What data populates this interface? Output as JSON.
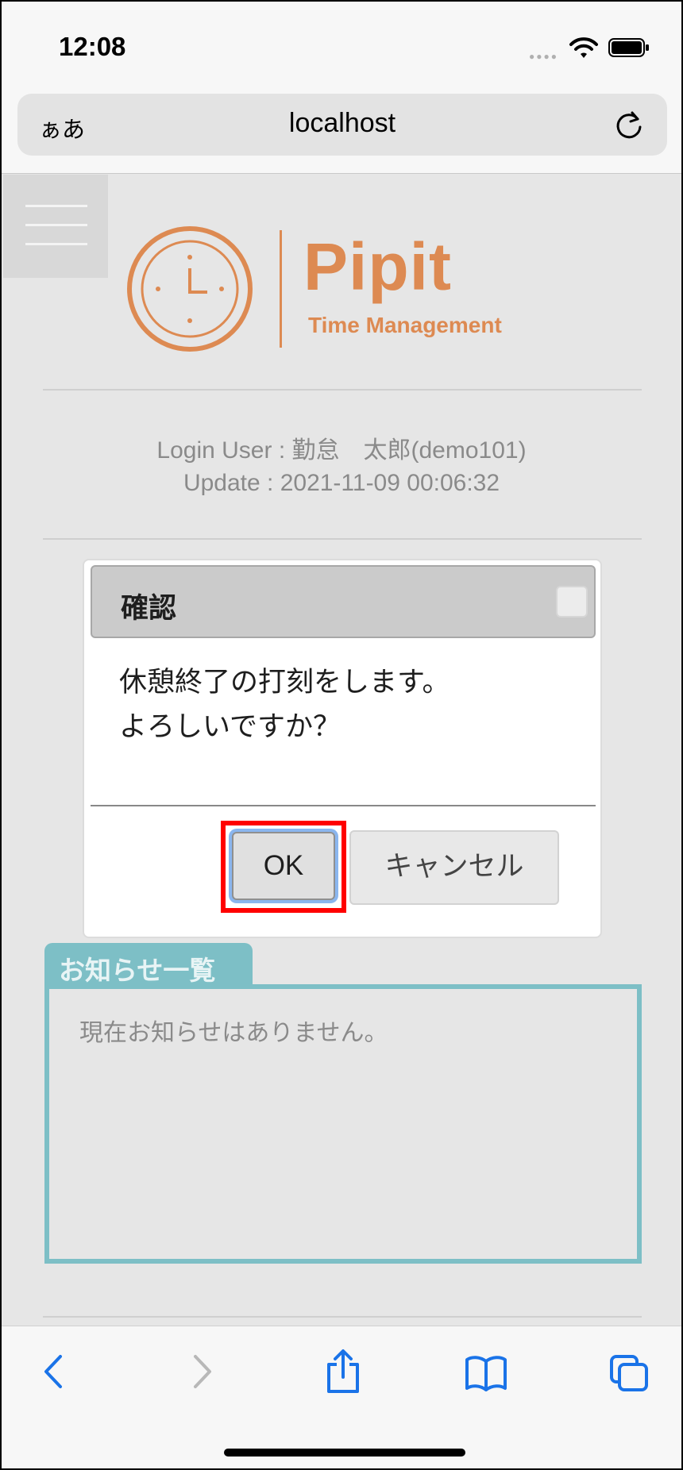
{
  "status_bar": {
    "time": "12:08"
  },
  "browser": {
    "text_size_label": "ぁあ",
    "host": "localhost"
  },
  "brand": {
    "name": "Pipit",
    "tagline": "Time Management",
    "color": "#dd8a52"
  },
  "user_info": {
    "login_line": "Login User : 勤怠　太郎(demo101)",
    "update_line": "Update : 2021-11-09 00:06:32"
  },
  "dialog": {
    "title": "確認",
    "message_line1": "休憩終了の打刻をします。",
    "message_line2": "よろしいですか？",
    "ok_label": "OK",
    "cancel_label": "キャンセル"
  },
  "notice": {
    "tab_label": "お知らせ一覧",
    "empty_message": "現在お知らせはありません。",
    "accent": "#7dbfc6"
  },
  "toolbar": {
    "icons": [
      "back-icon",
      "forward-icon",
      "share-icon",
      "bookmarks-icon",
      "tabs-icon"
    ]
  },
  "highlight": {
    "target": "ok-button",
    "color": "#ff0000"
  }
}
